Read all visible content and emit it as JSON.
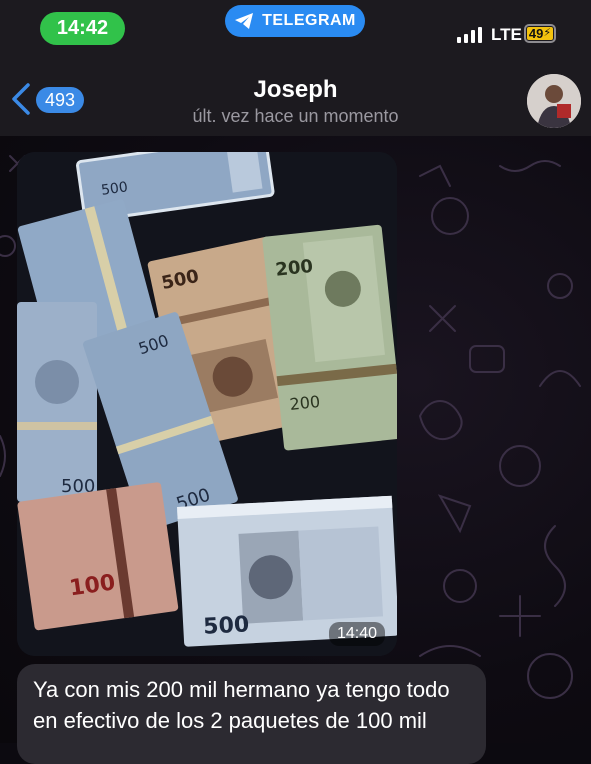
{
  "status_bar": {
    "time": "14:42",
    "app_pill": "TELEGRAM",
    "network": "LTE",
    "battery": "49"
  },
  "header": {
    "back_count": "493",
    "contact_name": "Joseph",
    "last_seen": "últ. vez hace un momento"
  },
  "messages": [
    {
      "type": "photo",
      "time": "14:40",
      "photo_subject": "stacks of Mexican peso banknotes"
    },
    {
      "type": "text",
      "text": "Ya con mis 200 mil hermano ya tengo todo en efectivo de los 2 paquetes de 100 mil"
    }
  ],
  "banknote_denominations": [
    "500",
    "200",
    "100"
  ],
  "colors": {
    "clock_pill": "#31c24a",
    "telegram_pill": "#2a8bf2",
    "unread_badge": "#3b8ae6",
    "battery": "#f3c20e",
    "incoming_bubble": "#2c2a31"
  }
}
